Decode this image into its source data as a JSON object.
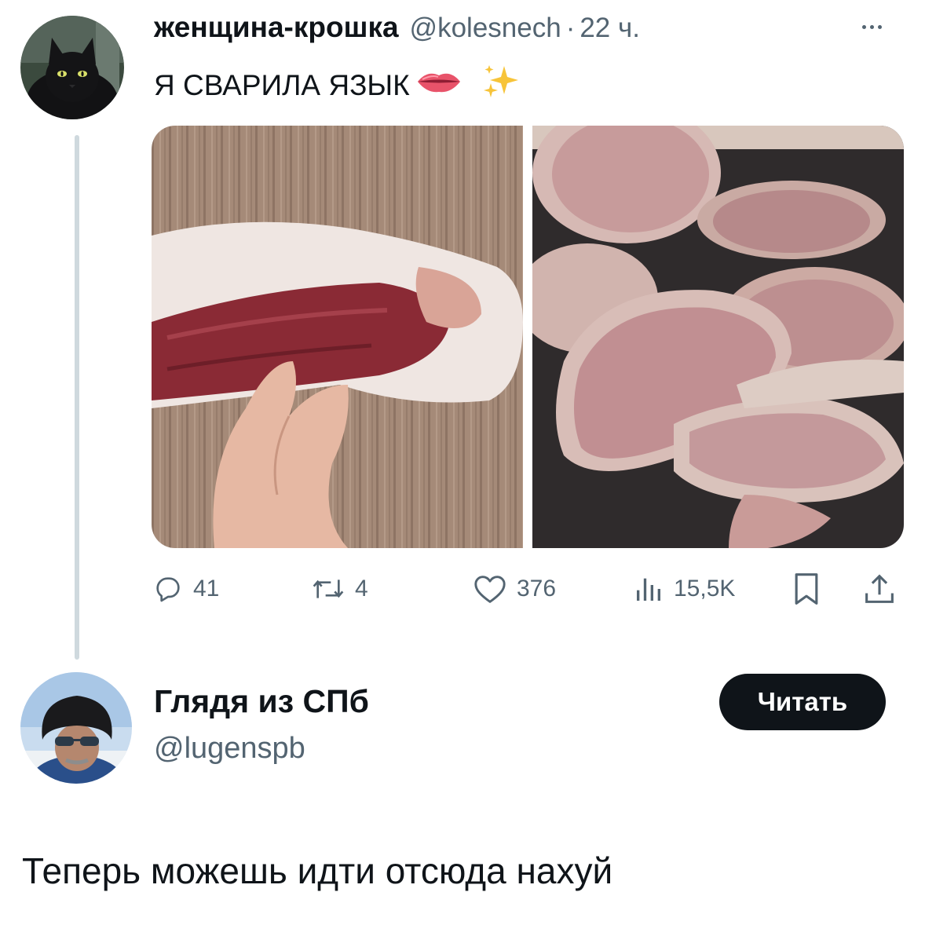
{
  "tweet": {
    "author_name": "женщина-крошка",
    "handle": "@kolesnech",
    "separator": "·",
    "time": "22 ч.",
    "text": "Я СВАРИЛА ЯЗЫК",
    "emojis": [
      "lips-emoji",
      "sparkles-emoji"
    ],
    "stats": {
      "replies": "41",
      "retweets": "4",
      "likes": "376",
      "views": "15,5K"
    },
    "icons": {
      "reply": "reply-icon",
      "retweet": "retweet-icon",
      "like": "heart-icon",
      "views": "views-icon",
      "bookmark": "bookmark-icon",
      "share": "share-icon",
      "more": "more-icon"
    }
  },
  "profile": {
    "name": "Глядя из СПб",
    "handle": "@lugenspb",
    "follow_label": "Читать"
  },
  "reply": {
    "text": "Теперь можешь идти отсюда нахуй"
  },
  "colors": {
    "text_primary": "#0f1419",
    "text_secondary": "#536471",
    "thread_line": "#cfd9de",
    "button_bg": "#0f1419"
  }
}
